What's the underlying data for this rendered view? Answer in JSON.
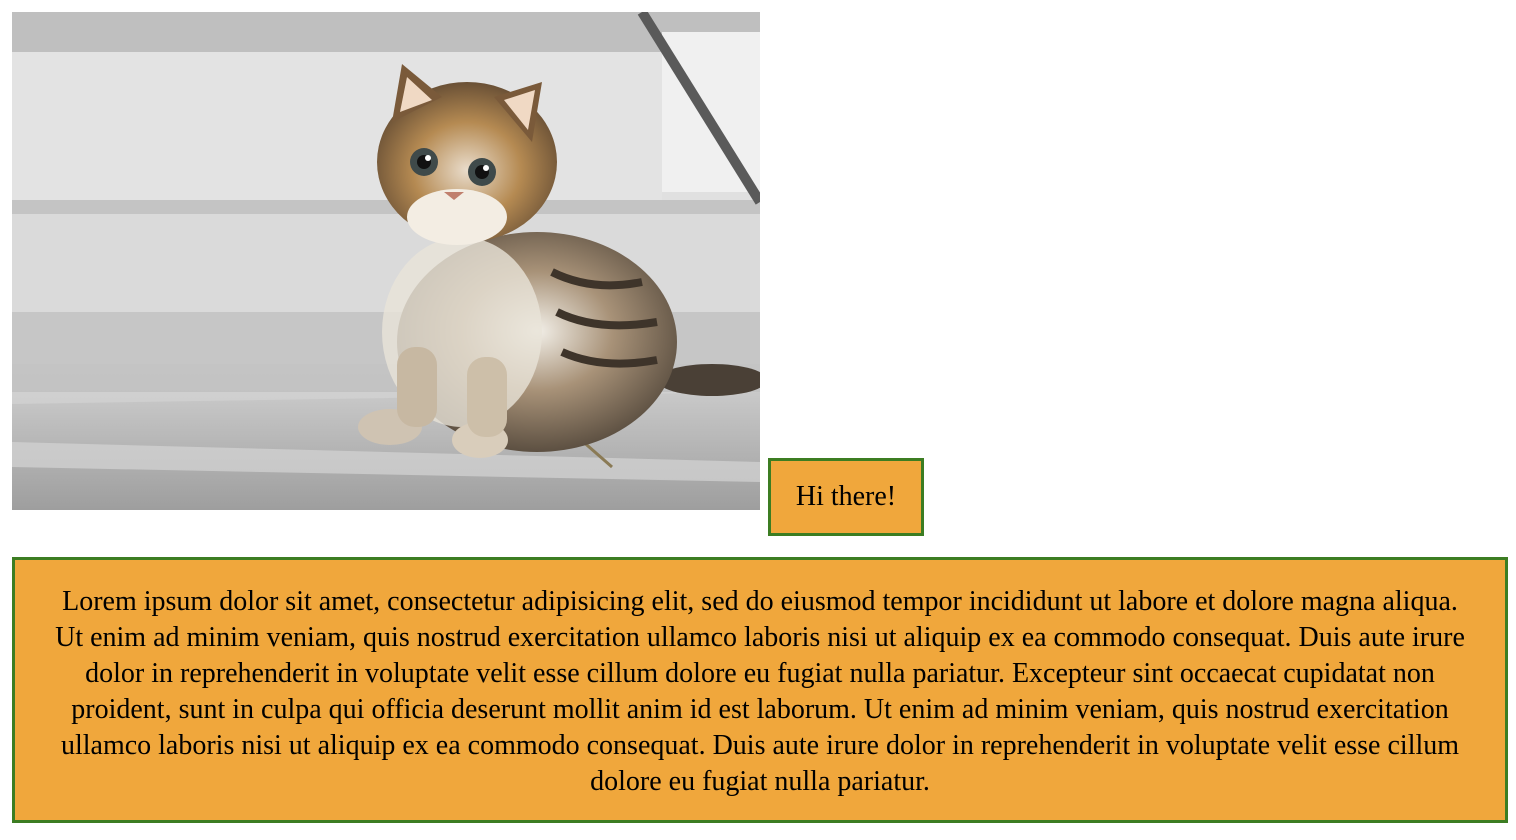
{
  "image": {
    "subject": "fluffy tabby kitten sitting on grey stairs",
    "icon": "kitten-photo"
  },
  "greeting": {
    "text": "Hi there!"
  },
  "paragraph": {
    "text": "Lorem ipsum dolor sit amet, consectetur adipisicing elit, sed do eiusmod tempor incididunt ut labore et dolore magna aliqua. Ut enim ad minim veniam, quis nostrud exercitation ullamco laboris nisi ut aliquip ex ea commodo consequat. Duis aute irure dolor in reprehenderit in voluptate velit esse cillum dolore eu fugiat nulla pariatur. Excepteur sint occaecat cupidatat non proident, sunt in culpa qui officia deserunt mollit anim id est laborum. Ut enim ad minim veniam, quis nostrud exercitation ullamco laboris nisi ut aliquip ex ea commodo consequat. Duis aute irure dolor in reprehenderit in voluptate velit esse cillum dolore eu fugiat nulla pariatur."
  },
  "colors": {
    "box_background": "#f0a73c",
    "box_border": "#3c7d22",
    "page_background": "#ffffff"
  }
}
